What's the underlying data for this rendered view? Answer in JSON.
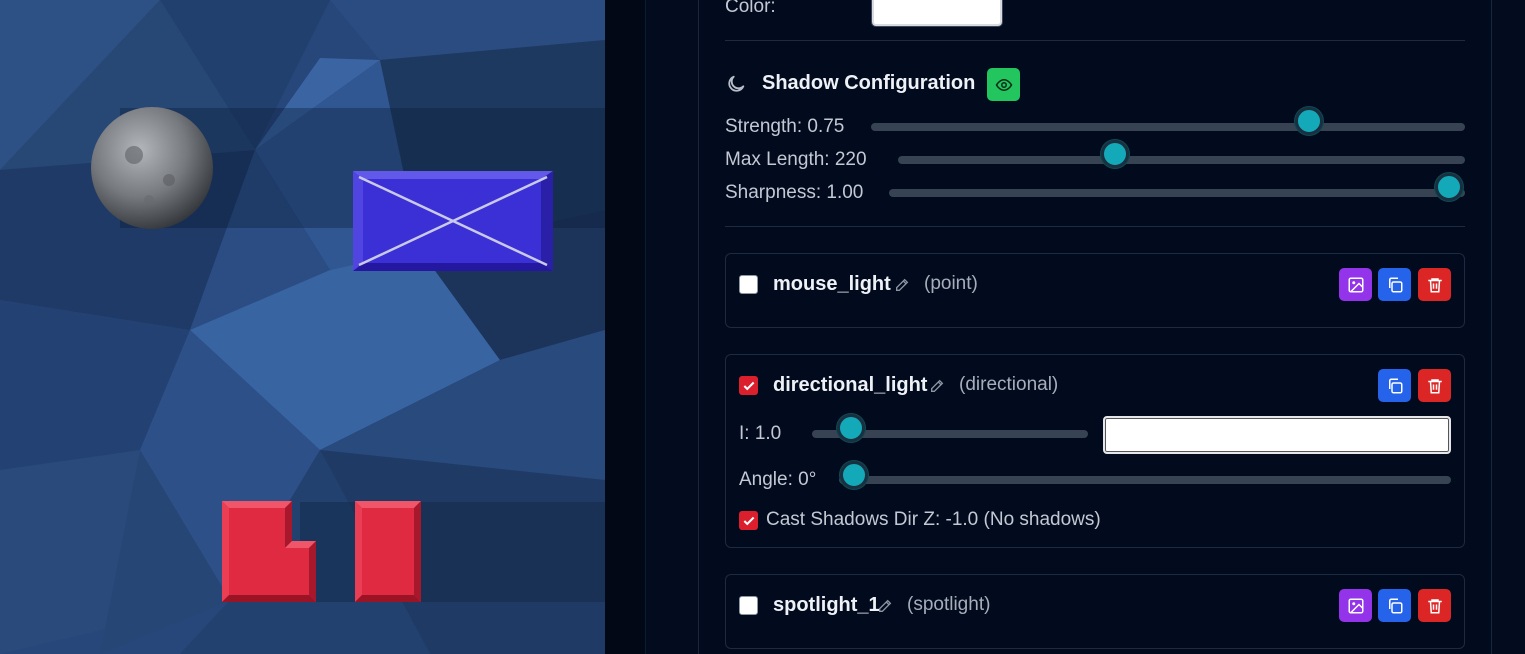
{
  "scene": {
    "background_color": "#27467a",
    "objects": [
      {
        "name": "moon-sphere",
        "color": "#8c8f94"
      },
      {
        "name": "blue-box",
        "color": "#3b2fd6"
      },
      {
        "name": "red-l-block",
        "color": "#e02a42"
      },
      {
        "name": "red-bar-block",
        "color": "#e02a42"
      }
    ]
  },
  "panel": {
    "color_row": {
      "label": "Color:",
      "value": "#ffffff"
    },
    "shadow": {
      "title": "Shadow Configuration",
      "title_icon": "moon-icon",
      "toggle_icon": "eye-icon",
      "sliders": [
        {
          "label": "Strength: 0.75",
          "value": 0.75,
          "min": 0,
          "max": 1
        },
        {
          "label": "Max Length: 220",
          "value": 220
        },
        {
          "label": "Sharpness: 1.00",
          "value": 1.0,
          "min": 0,
          "max": 1
        }
      ]
    },
    "lights": [
      {
        "name": "mouse_light",
        "type": "(point)",
        "enabled": false,
        "actions": [
          "image-icon",
          "copy-icon",
          "trash-icon"
        ]
      },
      {
        "name": "directional_light",
        "type": "(directional)",
        "enabled": true,
        "actions": [
          "copy-icon",
          "trash-icon"
        ],
        "intensity_label": "I: 1.0",
        "intensity": 1.0,
        "color": "#ffffff",
        "angle_label": "Angle: 0°",
        "angle": 0,
        "cast_shadows_label": "Cast Shadows Dir Z: -1.0 (No shadows)",
        "cast_shadows": true
      },
      {
        "name": "spotlight_1",
        "type": "(spotlight)",
        "enabled": false,
        "actions": [
          "image-icon",
          "copy-icon",
          "trash-icon"
        ]
      }
    ]
  },
  "colors": {
    "accent_teal": "#14a9b8",
    "eye_green": "#22c55e",
    "purple": "#9333ea",
    "blue": "#2563eb",
    "red": "#dc2626"
  }
}
